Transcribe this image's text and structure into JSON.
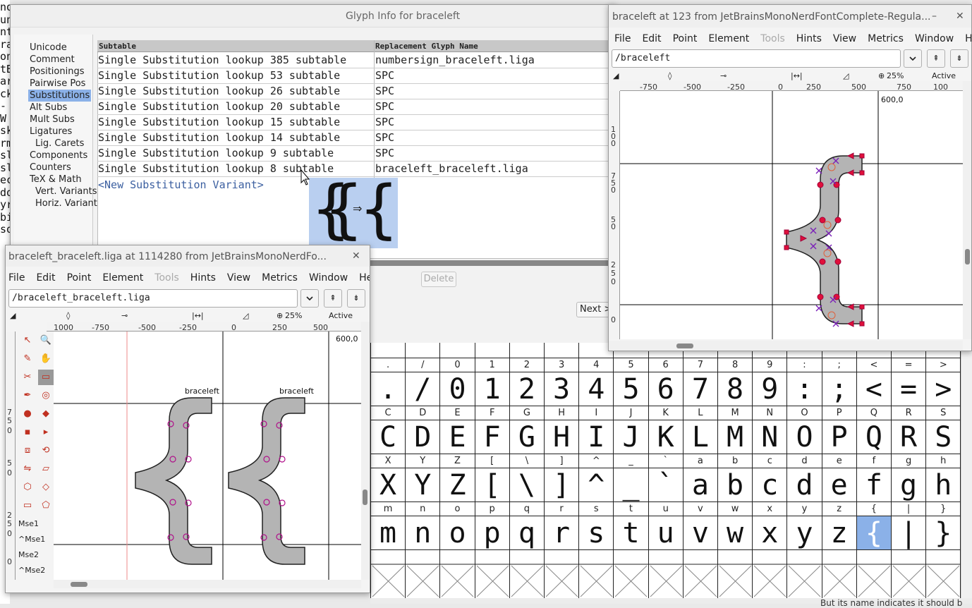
{
  "bg_terminal": {
    "lines": [
      "nof",
      "un",
      "nt",
      "ra",
      "on",
      "tB",
      "ar",
      "ck",
      "-W",
      "sk",
      "rm",
      "sl",
      "sl",
      "ec",
      "do",
      "yr",
      "bi",
      "so"
    ]
  },
  "glyph_info": {
    "title": "Glyph Info for braceleft",
    "sidebar": [
      "Unicode",
      "Comment",
      "Positionings",
      "Pairwise Pos",
      "Substitutions",
      "Alt Subs",
      "Mult Subs",
      "Ligatures",
      "Lig. Carets",
      "Components",
      "Counters",
      "TeX & Math",
      "Vert. Variants",
      "Horiz. Variants"
    ],
    "selected_index": 4,
    "col_subtable": "Subtable",
    "col_replacement": "Replacement Glyph Name",
    "rows": [
      {
        "subtable": "Single Substitution lookup 385 subtable",
        "replacement": "numbersign_braceleft.liga"
      },
      {
        "subtable": "Single Substitution lookup 53 subtable",
        "replacement": "SPC"
      },
      {
        "subtable": "Single Substitution lookup 26 subtable",
        "replacement": "SPC"
      },
      {
        "subtable": "Single Substitution lookup 20 subtable",
        "replacement": "SPC"
      },
      {
        "subtable": "Single Substitution lookup 15 subtable",
        "replacement": "SPC"
      },
      {
        "subtable": "Single Substitution lookup 14 subtable",
        "replacement": "SPC"
      },
      {
        "subtable": "Single Substitution lookup 9 subtable",
        "replacement": "SPC"
      },
      {
        "subtable": "Single Substitution lookup 8 subtable",
        "replacement": "braceleft_braceleft.liga"
      }
    ],
    "new_variant": "<New Substitution Variant>",
    "delete_label": "Delete",
    "next_label": "Next >",
    "tooltip_arrow": "⇒"
  },
  "liga_window": {
    "title": "braceleft_braceleft.liga at 1114280 from JetBrainsMonoNerdFo...",
    "close": "✕",
    "menu": [
      "File",
      "Edit",
      "Point",
      "Element",
      "Tools",
      "Hints",
      "View",
      "Metrics",
      "Window",
      "Help"
    ],
    "path_value": "/braceleft_braceleft.liga",
    "zoom": "25%",
    "active_layer": "Active Laye",
    "ruler_ticks": [
      "1000",
      "-750",
      "-500",
      "-250",
      "0",
      "250",
      "500"
    ],
    "advance_label": "600,0",
    "glyph_label_1": "braceleft",
    "glyph_label_2": "braceleft",
    "tool_labels": [
      "Mse1",
      "^Mse1",
      "Mse2",
      "^Mse2"
    ],
    "vruler": [
      "7",
      "5",
      "0",
      "5",
      "0",
      "2",
      "5",
      "0",
      "0"
    ]
  },
  "brace_window": {
    "title": "braceleft at 123 from JetBrainsMonoNerdFontComplete-Regula...",
    "minimize": "–",
    "close": "✕",
    "menu": [
      "File",
      "Edit",
      "Point",
      "Element",
      "Tools",
      "Hints",
      "View",
      "Metrics",
      "Window",
      "Help"
    ],
    "path_value": "/braceleft",
    "zoom": "25%",
    "active_layer": "Active Laye",
    "ruler_ticks": [
      "-750",
      "-500",
      "-250",
      "0",
      "250",
      "500",
      "750",
      "100"
    ],
    "advance_label": "600,0",
    "vruler": [
      "1",
      "0",
      "0",
      "7",
      "5",
      "0",
      "5",
      "0",
      "2",
      "5",
      "0",
      "0"
    ]
  },
  "font_grid": {
    "rows": [
      {
        "labels": [
          ".",
          "/",
          "0",
          "1",
          "2",
          "3",
          "4",
          "5",
          "6",
          "7",
          "8",
          "9",
          ":",
          ";",
          "<",
          "=",
          ">"
        ],
        "glyphs": [
          ".",
          "/",
          "0",
          "1",
          "2",
          "3",
          "4",
          "5",
          "6",
          "7",
          "8",
          "9",
          ":",
          ";",
          "<",
          "=",
          ">"
        ]
      },
      {
        "labels": [
          "C",
          "D",
          "E",
          "F",
          "G",
          "H",
          "I",
          "J",
          "K",
          "L",
          "M",
          "N",
          "O",
          "P",
          "Q",
          "R",
          "S"
        ],
        "glyphs": [
          "C",
          "D",
          "E",
          "F",
          "G",
          "H",
          "I",
          "J",
          "K",
          "L",
          "M",
          "N",
          "O",
          "P",
          "Q",
          "R",
          "S"
        ]
      },
      {
        "labels": [
          "X",
          "Y",
          "Z",
          "[",
          "\\",
          "]",
          "^",
          "_",
          "`",
          "a",
          "b",
          "c",
          "d",
          "e",
          "f",
          "g",
          "h"
        ],
        "glyphs": [
          "X",
          "Y",
          "Z",
          "[",
          "\\",
          "]",
          "^",
          "_",
          "`",
          "a",
          "b",
          "c",
          "d",
          "e",
          "f",
          "g",
          "h"
        ]
      },
      {
        "labels": [
          "m",
          "n",
          "o",
          "p",
          "q",
          "r",
          "s",
          "t",
          "u",
          "v",
          "w",
          "x",
          "y",
          "z",
          "{",
          "|",
          "}"
        ],
        "glyphs": [
          "m",
          "n",
          "o",
          "p",
          "q",
          "r",
          "s",
          "t",
          "u",
          "v",
          "w",
          "x",
          "y",
          "z",
          "{",
          "|",
          "}"
        ]
      }
    ],
    "selected_glyph": "{"
  },
  "status_text": "But its name indicates it should b"
}
